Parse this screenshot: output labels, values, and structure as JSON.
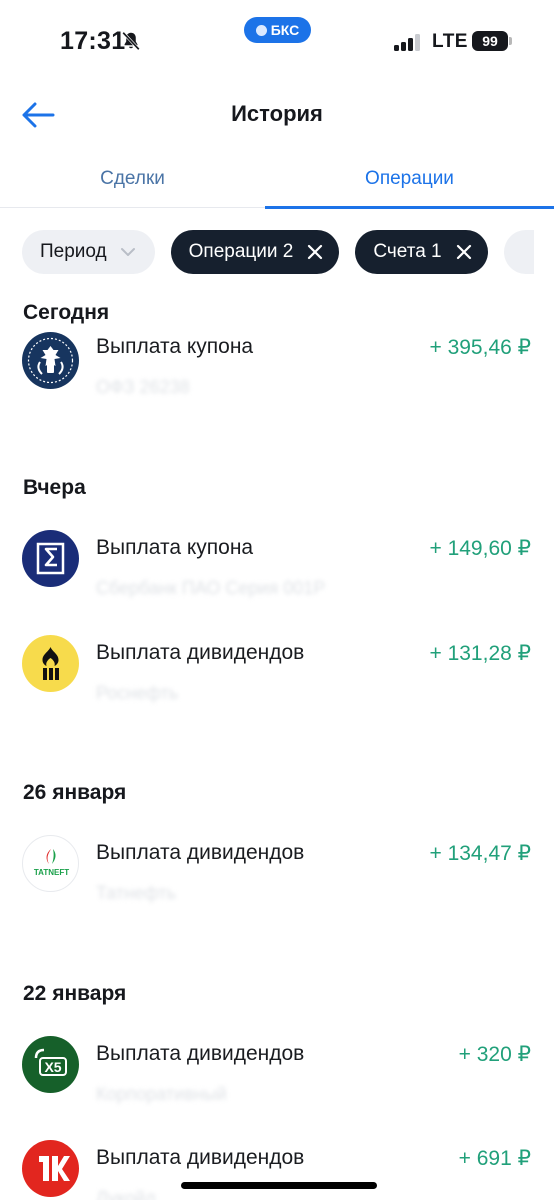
{
  "status_bar": {
    "time": "17:31",
    "carrier_badge": "БКС",
    "network": "LTE",
    "battery": "99",
    "silent_icon": "bell-slash-icon"
  },
  "header": {
    "title": "История",
    "back_icon": "arrow-left-icon"
  },
  "tabs": [
    {
      "label": "Сделки",
      "active": false
    },
    {
      "label": "Операции",
      "active": true
    }
  ],
  "filters": {
    "period": "Период",
    "operations": "Операции 2",
    "accounts": "Счета 1"
  },
  "sections": [
    {
      "title": "Сегодня",
      "items": [
        {
          "title": "Выплата купона",
          "amount": "+ 395,46 ₽",
          "subtitle": "ОФЗ 26238",
          "icon": "minfin-eagle-icon"
        }
      ]
    },
    {
      "title": "Вчера",
      "items": [
        {
          "title": "Выплата купона",
          "amount": "+ 149,60 ₽",
          "subtitle": "Сбербанк ПАО Серия 001Р",
          "icon": "bond-issuer-icon"
        },
        {
          "title": "Выплата дивидендов",
          "amount": "+ 131,28 ₽",
          "subtitle": "Роснефть",
          "icon": "rosneft-icon"
        }
      ]
    },
    {
      "title": "26 января",
      "items": [
        {
          "title": "Выплата дивидендов",
          "amount": "+ 134,47 ₽",
          "subtitle": "Татнефть",
          "icon": "tatneft-icon",
          "logo_text": "TATNEFT"
        }
      ]
    },
    {
      "title": "22 января",
      "items": [
        {
          "title": "Выплата дивидендов",
          "amount": "+ 320 ₽",
          "subtitle": "Корпоративный",
          "icon": "x5-icon",
          "logo_text": "X5"
        },
        {
          "title": "Выплата дивидендов",
          "amount": "+ 691 ₽",
          "subtitle": "Лукойл",
          "icon": "lukoil-icon"
        }
      ]
    }
  ],
  "colors": {
    "accent": "#1c73e8",
    "positive": "#21a07a",
    "chip_dark": "#16202e"
  }
}
